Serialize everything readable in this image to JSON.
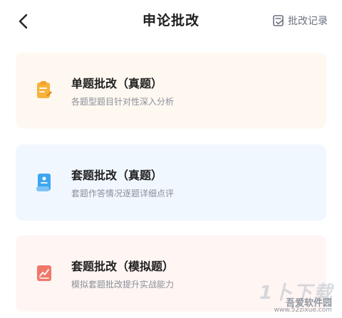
{
  "header": {
    "title": "申论批改",
    "record_label": "批改记录"
  },
  "cards": [
    {
      "title": "单题批改（真题）",
      "desc": "各题型题目针对性深入分析",
      "icon": "clipboard-icon",
      "bg": "#fff8f1",
      "icon_color": "#f7b23b"
    },
    {
      "title": "套题批改（真题）",
      "desc": "套题作答情况逐题详细点评",
      "icon": "document-icon",
      "bg": "#f1f7ff",
      "icon_color": "#3ea6f0"
    },
    {
      "title": "套题批改（模拟题）",
      "desc": "模拟套题批改提升实战能力",
      "icon": "chart-report-icon",
      "bg": "#fff5f3",
      "icon_color": "#f0776a"
    }
  ],
  "watermark": {
    "name": "吾爱软件园",
    "url": "www.52zixue.com"
  }
}
